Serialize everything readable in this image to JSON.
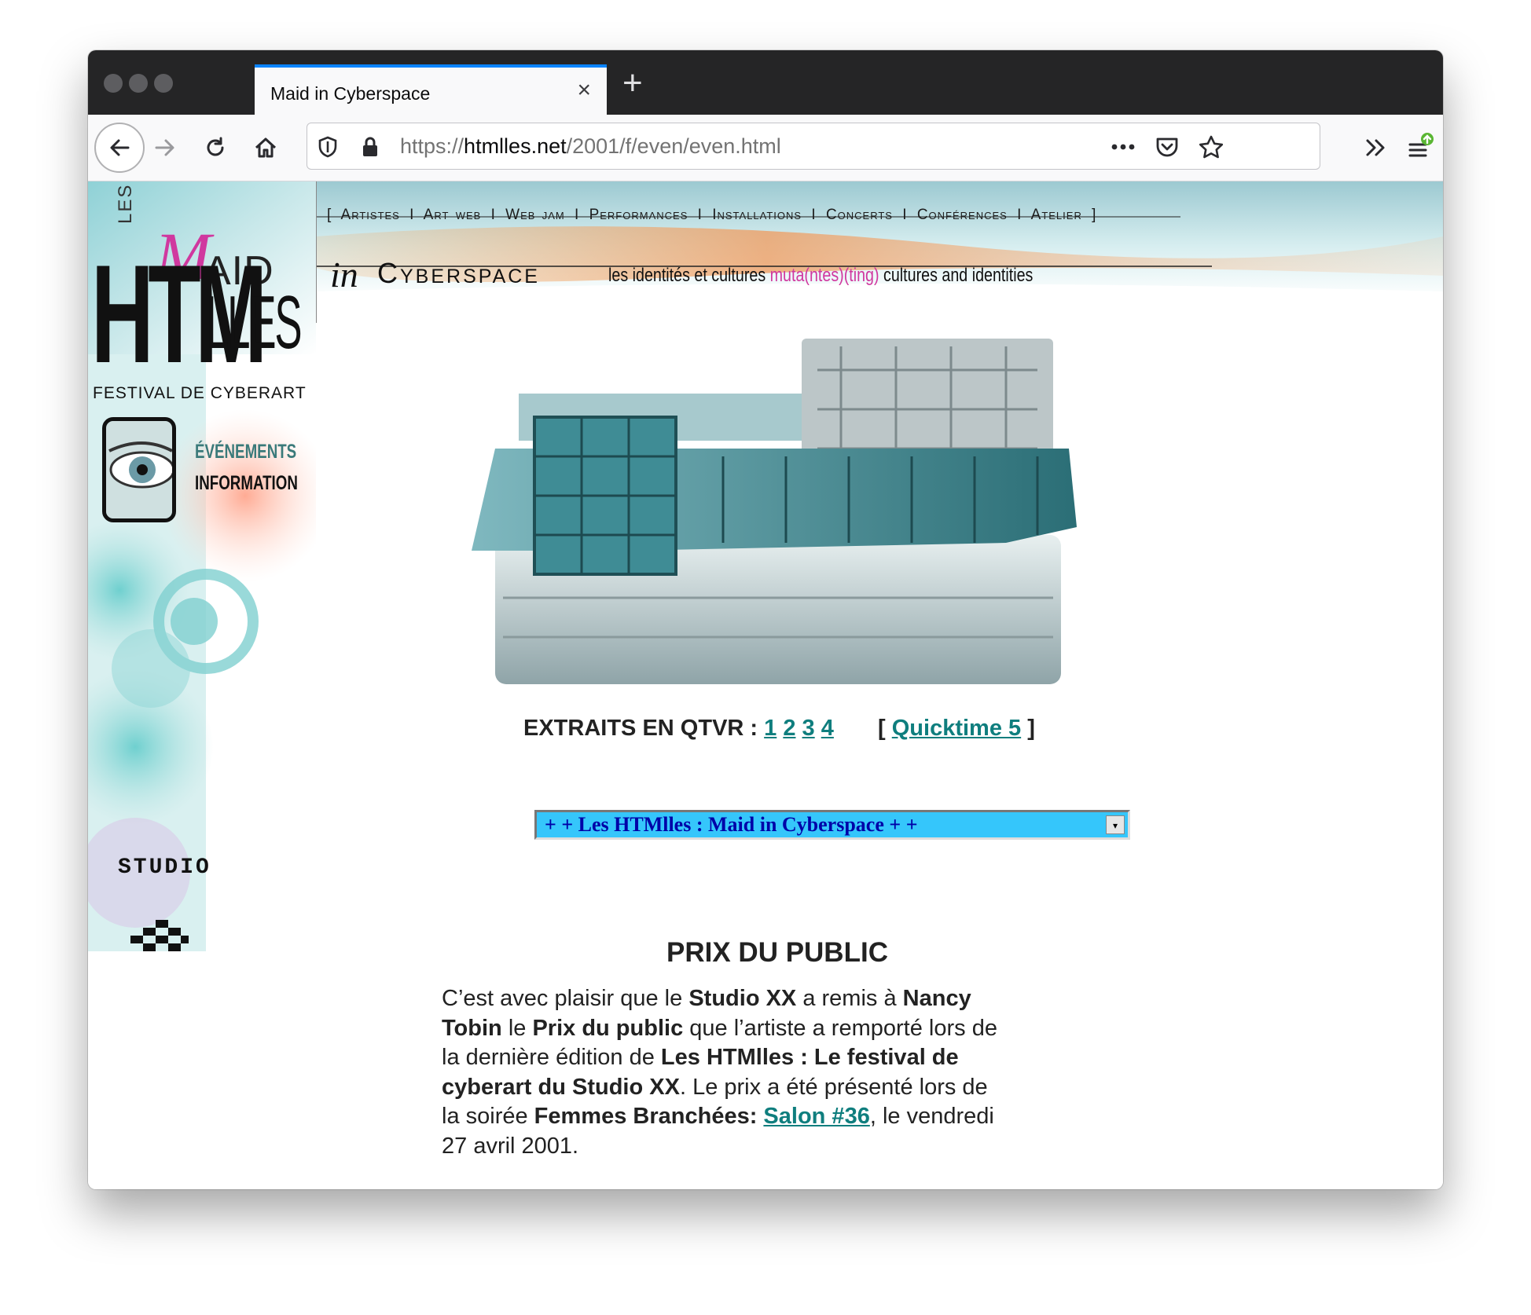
{
  "browser": {
    "tab_title": "Maid in Cyberspace",
    "tab_close": "×",
    "new_tab": "+",
    "url_scheme": "https://",
    "url_host": "htmlles.net",
    "url_path": "/2001/f/even/even.html",
    "icons": [
      "back-arrow-icon",
      "forward-arrow-icon",
      "reload-icon",
      "home-icon",
      "shield-icon",
      "lock-icon",
      "more-icon",
      "pocket-icon",
      "star-icon",
      "overflow-chevron-icon",
      "menu-icon",
      "update-badge-icon"
    ],
    "accent": "#0a84ff"
  },
  "header": {
    "nav_links": [
      "Artistes",
      "Art web",
      "Web jam",
      "Performances",
      "Installations",
      "Concerts",
      "Conférences",
      "Atelier"
    ],
    "logo_les": "LES",
    "logo_maid_m": "M",
    "logo_maid_rest": "AID",
    "logo_in": "in",
    "logo_cyberspace": "Cyberspace",
    "tagline_part1": "les identités et cultures",
    "tagline_pink": "muta(ntes)(ting)",
    "tagline_part2": "cultures and identities"
  },
  "sidebar": {
    "logo_htm": "HTM",
    "logo_lles": "LLES",
    "festival": "FESTIVAL DE CYBERART",
    "menu_events": "ÉVÉNEMENTS",
    "menu_info": "INFORMATION",
    "studio": "STUDIO"
  },
  "main": {
    "qtvr_label": "EXTRAITS EN QTVR :",
    "qtvr_links": [
      "1",
      "2",
      "3",
      "4"
    ],
    "quicktime_open": "[",
    "quicktime_link": "Quicktime 5",
    "quicktime_close": "]",
    "select_value": "+ + Les HTMlles : Maid in Cyberspace + +",
    "select_arrow": "▾",
    "prix_title": "PRIX DU PUBLIC",
    "prix": {
      "t1": "C’est avec plaisir que le ",
      "b1": "Studio XX",
      "t2": " a remis à ",
      "b2": "Nancy Tobin",
      "t3": " le ",
      "b3": "Prix du public",
      "t4": " que l’artiste a remporté lors de la dernière édition de ",
      "b4": "Les HTMlles : Le festival de cyberart du Studio XX",
      "t5": ". Le prix a été présenté lors de la soirée ",
      "b5": "Femmes Branchées:",
      "t6": " ",
      "link": "Salon #36",
      "t7": ", le vendredi 27 avril 2001."
    },
    "link_color": "#0f7e7e",
    "select_bg": "#35c6fb"
  }
}
